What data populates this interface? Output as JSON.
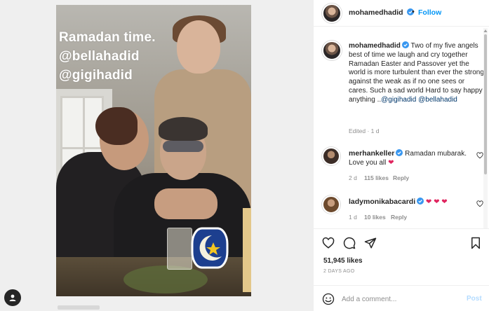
{
  "story": {
    "overlay_lines": [
      "Ramadan time.",
      "@bellahadid",
      "@gigihadid"
    ],
    "sticker": "crescent-moon-star-icon"
  },
  "header": {
    "username": "mohamedhadid",
    "separator": "•",
    "follow_label": "Follow"
  },
  "caption": {
    "username": "mohamedhadid",
    "text": "Two of my five angels best of time we laugh and cry together Ramadan Easter and Passover yet the world is more turbulent than ever the strong against the weak as if no one sees or cares. Such a sad world Hard to say happy anything ..",
    "mention_1": "@gigihadid",
    "mention_2": "@bellahadid",
    "edited": "Edited · 1 d"
  },
  "comments": [
    {
      "username": "merhankeller",
      "text": "Ramadan mubarak. Love you all",
      "emoji": "❤",
      "age": "2 d",
      "likes": "115 likes",
      "reply": "Reply"
    },
    {
      "username": "ladymonikabacardi",
      "text": "",
      "emoji": "❤ ❤ ❤",
      "age": "1 d",
      "likes": "10 likes",
      "reply": "Reply"
    }
  ],
  "actions": {
    "like_icon": "heart-icon",
    "comment_icon": "comment-icon",
    "share_icon": "paper-plane-icon",
    "save_icon": "bookmark-icon"
  },
  "likes_count": "51,945 likes",
  "posted_ago": "2 DAYS AGO",
  "add_comment": {
    "placeholder": "Add a comment...",
    "post_label": "Post"
  },
  "colors": {
    "accent": "#0095f6",
    "verified": "#3897f0",
    "heart": "#e0245e",
    "muted": "#8e8e8e"
  }
}
